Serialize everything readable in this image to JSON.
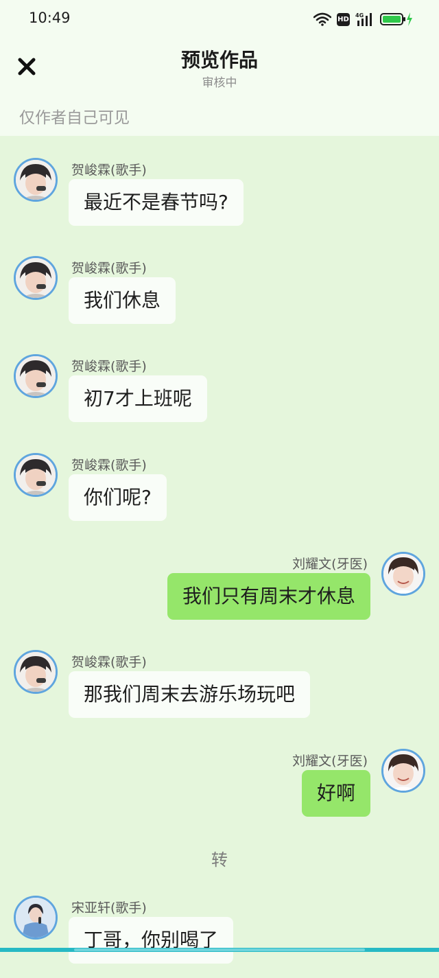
{
  "status_bar": {
    "time": "10:49",
    "hd": "HD",
    "network": "4G"
  },
  "header": {
    "title": "预览作品",
    "subtitle": "审核中",
    "close_icon": "close-icon",
    "visibility_note": "仅作者自己可见"
  },
  "messages": [
    {
      "side": "left",
      "sender": "贺峻霖(歌手)",
      "text": "最近不是春节吗?"
    },
    {
      "side": "left",
      "sender": "贺峻霖(歌手)",
      "text": "我们休息"
    },
    {
      "side": "left",
      "sender": "贺峻霖(歌手)",
      "text": "初7才上班呢"
    },
    {
      "side": "left",
      "sender": "贺峻霖(歌手)",
      "text": "你们呢?"
    },
    {
      "side": "right",
      "sender": "刘耀文(牙医)",
      "text": "我们只有周末才休息"
    },
    {
      "side": "left",
      "sender": "贺峻霖(歌手)",
      "text": "那我们周末去游乐场玩吧"
    },
    {
      "side": "right",
      "sender": "刘耀文(牙医)",
      "text": "好啊"
    }
  ],
  "divider": "转",
  "last_message": {
    "side": "left",
    "sender": "宋亚轩(歌手)",
    "text": "丁哥，你别喝了"
  },
  "colors": {
    "background": "#e5f6dc",
    "header_bg": "#f4fcf1",
    "left_bubble": "#f9fdf8",
    "right_bubble": "#95e66a",
    "avatar_ring": "#5fa5de",
    "battery": "#2fc84a"
  }
}
